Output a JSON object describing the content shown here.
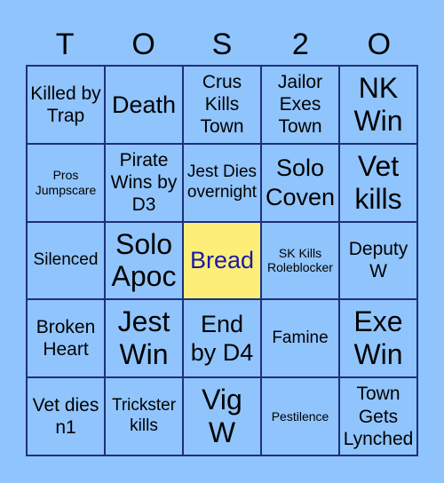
{
  "title_letters": [
    "T",
    "O",
    "S",
    "2",
    "O"
  ],
  "colors": {
    "background": "#90c4fc",
    "cell": "#90c4fc",
    "free_cell": "#fdee78",
    "free_text": "#1a1aa6",
    "border": "#1f2f7a"
  },
  "cells": [
    [
      "Killed by Trap",
      "Death",
      "Crus Kills Town",
      "Jailor Exes Town",
      "NK Win"
    ],
    [
      "Pros Jumpscare",
      "Pirate Wins by D3",
      "Jest Dies overnight",
      "Solo Coven",
      "Vet kills"
    ],
    [
      "Silenced",
      "Solo Apoc",
      "Bread",
      "SK Kills Roleblocker",
      "Deputy W"
    ],
    [
      "Broken Heart",
      "Jest Win",
      "End by D4",
      "Famine",
      "Exe Win"
    ],
    [
      "Vet dies n1",
      "Trickster kills",
      "Vig W",
      "Pestilence",
      "Town Gets Lynched"
    ]
  ],
  "free_space": "Bread"
}
